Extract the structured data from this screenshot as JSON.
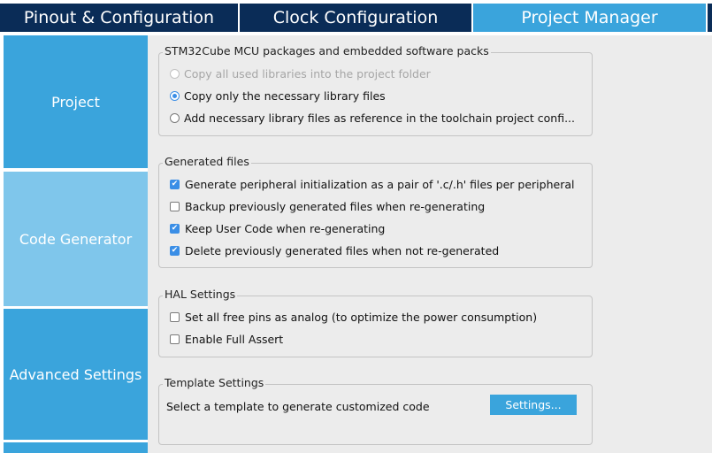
{
  "tabs": [
    {
      "label": "Pinout & Configuration",
      "active": false
    },
    {
      "label": "Clock Configuration",
      "active": false
    },
    {
      "label": "Project Manager",
      "active": true
    }
  ],
  "sidebar": {
    "items": [
      {
        "label": "Project",
        "selected": false
      },
      {
        "label": "Code Generator",
        "selected": true
      },
      {
        "label": "Advanced Settings",
        "selected": false
      }
    ]
  },
  "packages": {
    "legend": "STM32Cube MCU packages and embedded software packs",
    "options": [
      {
        "label": "Copy all used libraries into the project folder",
        "checked": false,
        "disabled": true
      },
      {
        "label": "Copy only the necessary library files",
        "checked": true,
        "disabled": false
      },
      {
        "label": "Add necessary library files as reference in the toolchain project confi...",
        "checked": false,
        "disabled": false
      }
    ]
  },
  "generated": {
    "legend": "Generated files",
    "options": [
      {
        "label": "Generate peripheral initialization as a pair of '.c/.h' files per peripheral",
        "checked": true
      },
      {
        "label": "Backup previously generated files when re-generating",
        "checked": false
      },
      {
        "label": "Keep User Code when re-generating",
        "checked": true
      },
      {
        "label": "Delete previously generated files when not re-generated",
        "checked": true
      }
    ]
  },
  "hal": {
    "legend": "HAL Settings",
    "options": [
      {
        "label": "Set all free pins as analog (to optimize the power consumption)",
        "checked": false
      },
      {
        "label": "Enable Full Assert",
        "checked": false
      }
    ]
  },
  "template": {
    "legend": "Template Settings",
    "description": "Select a template to generate customized code",
    "button": "Settings..."
  },
  "colors": {
    "tab_dark": "#0a2c57",
    "accent": "#3aa4dc",
    "sidebar_selected": "#7fc6eb",
    "panel": "#ececec",
    "check_blue": "#3a8ee6"
  }
}
